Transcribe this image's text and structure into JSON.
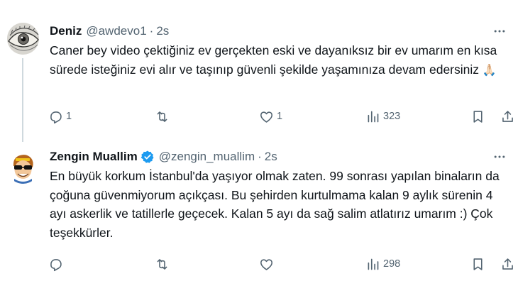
{
  "tweets": [
    {
      "name": "Deniz",
      "handle": "@awdevo1",
      "separator": "·",
      "time": "2s",
      "text": "Caner bey video çektiğiniz ev gerçekten eski ve dayanıksız bir ev umarım en kısa sürede isteğiniz evi alır ve taşınıp güvenli şekilde yaşamınıza devam edersiniz ",
      "emoji": "🙏🏻",
      "replies": "1",
      "retweets": "",
      "likes": "1",
      "views": "323",
      "avatar_icon": "eye-illustration-avatar"
    },
    {
      "name": "Zengin Muallim",
      "handle": "@zengin_muallim",
      "separator": "·",
      "time": "2s",
      "verified": true,
      "text": "En büyük korkum İstanbul'da yaşıyor olmak zaten. 99 sonrası yapılan binaların da çoğuna güvenmiyorum açıkçası. Bu şehirden kurtulmama kalan 9 aylık sürenin 4 ayı askerlik ve tatillerle geçecek. Kalan 5 ayı da sağ salim atlatırız umarım :) Çok teşekkürler.",
      "replies": "",
      "retweets": "",
      "likes": "",
      "views": "298",
      "avatar_icon": "cartoon-man-avatar"
    }
  ],
  "colors": {
    "text": "#0f1419",
    "secondary": "#536471",
    "verified": "#1d9bf0",
    "thread_line": "#cfd9de"
  }
}
